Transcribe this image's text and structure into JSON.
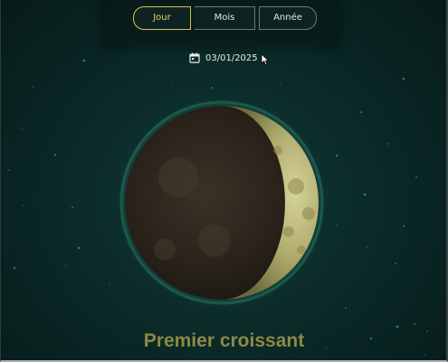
{
  "view_toggle": {
    "day_label": "Jour",
    "month_label": "Mois",
    "year_label": "Année",
    "active": "day"
  },
  "date_picker": {
    "value": "03/01/2025",
    "icon": "calendar-icon"
  },
  "moon": {
    "phase_name": "Premier croissant",
    "illuminated_side": "right"
  },
  "colors": {
    "accent": "#d8c24a",
    "phase_text": "#8b8a45",
    "background": "#0b2b29"
  }
}
